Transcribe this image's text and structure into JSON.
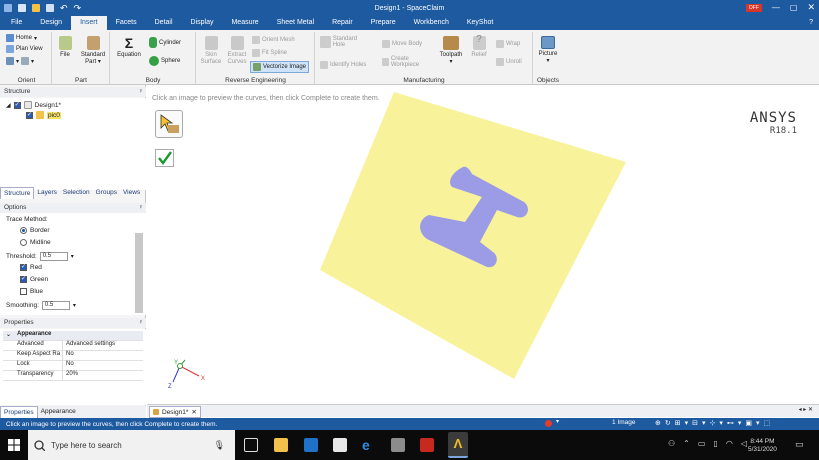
{
  "window": {
    "title": "Design1 - SpaceClaim",
    "badge": "OFF"
  },
  "menu": [
    "File",
    "Design",
    "Insert",
    "Facets",
    "Detail",
    "Display",
    "Measure",
    "Sheet Metal",
    "Repair",
    "Prepare",
    "Workbench",
    "KeyShot"
  ],
  "ribbon": {
    "orient": {
      "label": "Orient",
      "home": "Home",
      "plan_view": "Plan View"
    },
    "part": {
      "label": "Part",
      "file": "File",
      "standard_part": "Standard Part"
    },
    "body": {
      "label": "Body",
      "equation": "Equation",
      "cylinder": "Cylinder",
      "sphere": "Sphere"
    },
    "reverse": {
      "label": "Reverse Engineering",
      "skin_surface": "Skin Surface",
      "extract_curves": "Extract Curves",
      "orient_mesh": "Orient Mesh",
      "fit_spline": "Fit Spline",
      "vectorize_image": "Vectorize Image"
    },
    "manufacturing": {
      "label": "Manufacturing",
      "standard_hole": "Standard Hole",
      "identify_holes": "Identify Holes",
      "move_body": "Move Body",
      "create_workpiece": "Create Workpiece",
      "toolpath": "Toolpath",
      "relief": "Relief",
      "wrap": "Wrap",
      "unroll": "Unroll"
    },
    "objects": {
      "label": "Objects",
      "picture": "Picture"
    }
  },
  "structure": {
    "header": "Structure",
    "tree": [
      "Design1*",
      "pic0"
    ],
    "tabs": [
      "Structure",
      "Layers",
      "Selection",
      "Groups",
      "Views"
    ]
  },
  "options": {
    "header": "Options",
    "trace_method_label": "Trace Method:",
    "border": "Border",
    "midline": "Midline",
    "threshold_label": "Threshold:",
    "threshold_value": "0.5",
    "red": "Red",
    "green": "Green",
    "blue": "Blue",
    "smoothing_label": "Smoothing:",
    "smoothing_value": "0.5"
  },
  "properties": {
    "header": "Properties",
    "section": "Appearance",
    "rows": [
      {
        "key": "Advanced",
        "value": "Advanced settings"
      },
      {
        "key": "Keep Aspect Ra",
        "value": "No"
      },
      {
        "key": "Lock",
        "value": "No"
      },
      {
        "key": "Transparency",
        "value": "20%"
      }
    ],
    "tabs": [
      "Properties",
      "Appearance"
    ]
  },
  "canvas": {
    "hint": "Click an image to preview the curves, then click Complete to create them.",
    "brand": "ANSYS",
    "version": "R18.1",
    "image_color": "#f8f39a",
    "shape_color": "#9b9be6",
    "doc_tab": "Design1*"
  },
  "status": {
    "message": "Click an image to preview the curves, then click Complete to create them.",
    "selection": "1 Image"
  },
  "taskbar": {
    "search_placeholder": "Type here to search",
    "time": "8:44 PM",
    "date": "5/31/2020"
  }
}
